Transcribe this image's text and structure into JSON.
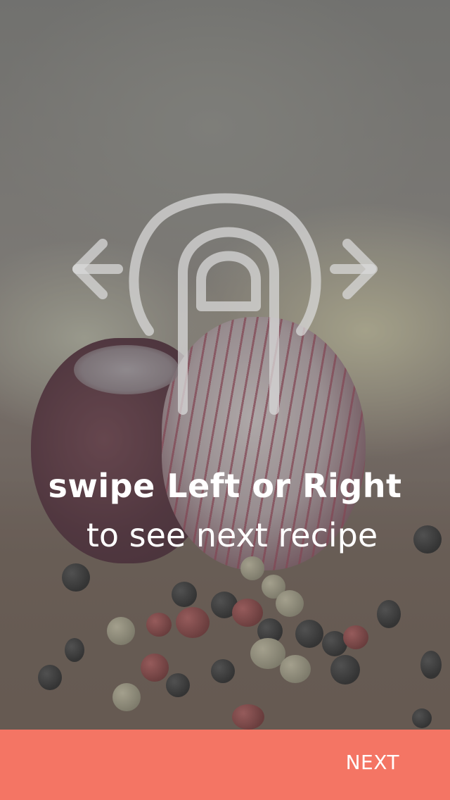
{
  "onboarding": {
    "headline": "swipe Left or Right",
    "subline": "to see next recipe"
  },
  "gesture_icon": {
    "name": "swipe-left-right-icon",
    "color": "#d8d8d8"
  },
  "footer": {
    "next_label": "NEXT",
    "bar_color": "#f47564"
  }
}
